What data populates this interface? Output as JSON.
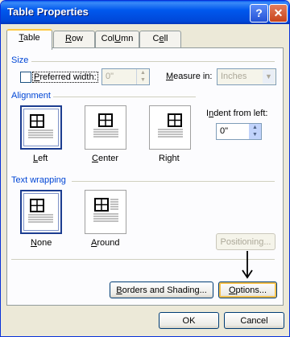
{
  "window": {
    "title": "Table Properties",
    "help_glyph": "?",
    "close_glyph": "✕"
  },
  "tabs": [
    {
      "label": "Table",
      "u": "T",
      "rest": "able"
    },
    {
      "label": "Row",
      "u": "R",
      "rest": "ow"
    },
    {
      "label": "Column",
      "u": "U",
      "pre": "Col",
      "rest": "mn"
    },
    {
      "label": "Cell",
      "pre": "C",
      "u": "e",
      "rest": "ll"
    }
  ],
  "size": {
    "section": "Size",
    "preferred_width_label_u": "P",
    "preferred_width_label_rest": "referred width:",
    "preferred_width_value": "0\"",
    "measure_label_u": "M",
    "measure_label_rest": "easure in:",
    "measure_value": "Inches"
  },
  "alignment": {
    "section": "Alignment",
    "indent_label_pre": "I",
    "indent_label_u": "n",
    "indent_label_rest": "dent from left:",
    "indent_value": "0\"",
    "options": [
      {
        "label": "Left",
        "u": "L",
        "rest": "eft"
      },
      {
        "label": "Center",
        "u": "C",
        "rest": "enter"
      },
      {
        "label": "Right",
        "pre": "Ri",
        "u": "g",
        "rest": "ht"
      }
    ]
  },
  "text_wrapping": {
    "section": "Text wrapping",
    "options": [
      {
        "label": "None",
        "u": "N",
        "rest": "one"
      },
      {
        "label": "Around",
        "u": "A",
        "rest": "round"
      }
    ],
    "positioning_label": "Positioning..."
  },
  "buttons": {
    "borders_u": "B",
    "borders_rest": "orders and Shading...",
    "options_u": "O",
    "options_rest": "ptions...",
    "ok": "OK",
    "cancel": "Cancel"
  }
}
